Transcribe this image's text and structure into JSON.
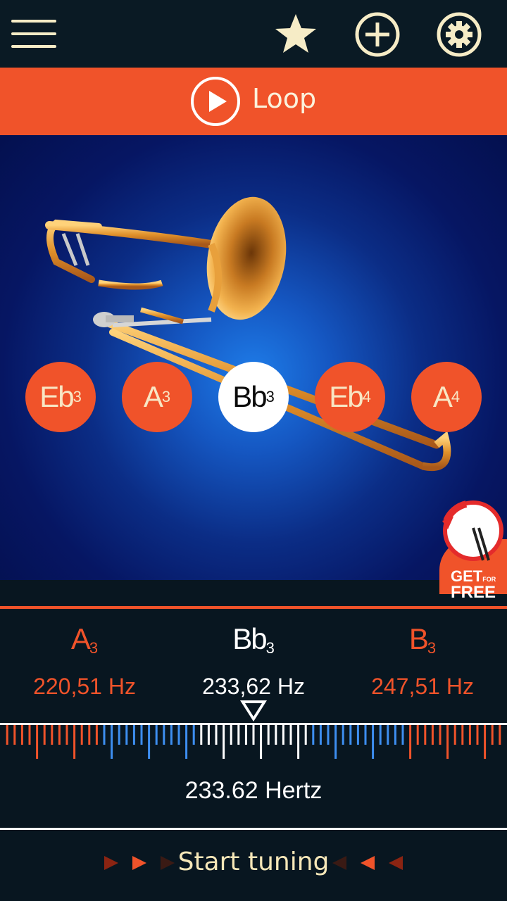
{
  "topbar": {
    "menu_icon": "hamburger-menu-icon",
    "favorite_icon": "star-icon",
    "add_icon": "plus-circle-icon",
    "settings_icon": "gear-icon"
  },
  "loop": {
    "label": "Loop",
    "icon": "play-circle-icon"
  },
  "instrument": {
    "image": "trombone-illustration"
  },
  "notes": [
    {
      "name": "Eb",
      "octave": "3",
      "active": false
    },
    {
      "name": "A",
      "octave": "3",
      "active": false
    },
    {
      "name": "Bb",
      "octave": "3",
      "active": true
    },
    {
      "name": "Eb",
      "octave": "4",
      "active": false
    },
    {
      "name": "A",
      "octave": "4",
      "active": false
    }
  ],
  "promo": {
    "line1": "GET",
    "line1_small": "FOR",
    "line2": "FREE",
    "icon": "metronome-app-icon"
  },
  "tuner": {
    "lower": {
      "name": "A",
      "octave": "3",
      "hz": "220,51 Hz"
    },
    "current": {
      "name": "Bb",
      "octave": "3",
      "hz": "233,62 Hz"
    },
    "upper": {
      "name": "B",
      "octave": "3",
      "hz": "247,51 Hz"
    },
    "frequency": "233.62 Hertz"
  },
  "start": {
    "label": "Start tuning"
  },
  "colors": {
    "accent": "#f0532a",
    "background": "#081620",
    "cream": "#f6ecc6",
    "blue_tick": "#3d8ef0"
  }
}
